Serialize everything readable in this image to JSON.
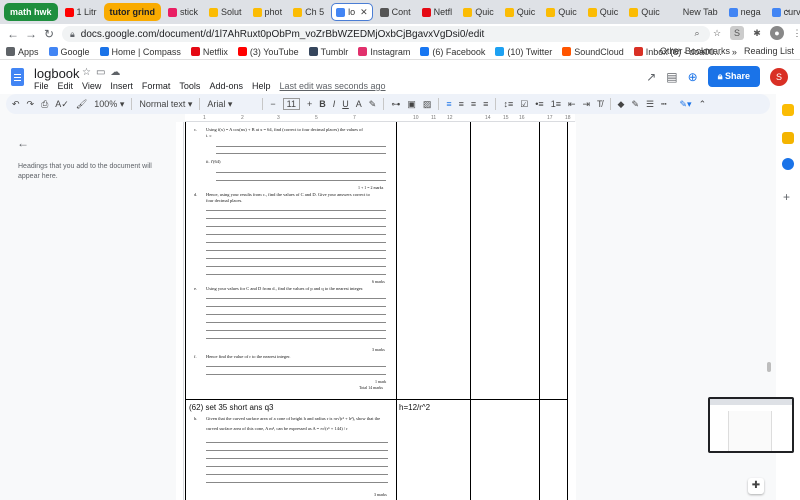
{
  "tabs": [
    {
      "label": "math hwk",
      "group": true,
      "color": "#1e8e3e"
    },
    {
      "label": "1 Litr",
      "color": "#ff0000"
    },
    {
      "label": "tutor grind",
      "group": true,
      "color": "#f9ab00",
      "text_color": "#202124"
    },
    {
      "label": "stick",
      "color": "#e91e63"
    },
    {
      "label": "Solut",
      "color": "#fbbc04"
    },
    {
      "label": "phot",
      "color": "#fbbc04"
    },
    {
      "label": "Ch 5",
      "color": "#fbbc04"
    },
    {
      "label": "lo",
      "active": true,
      "color": "#4285f4"
    },
    {
      "label": "Cont",
      "color": "#555555"
    },
    {
      "label": "Netfl",
      "color": "#e50914"
    },
    {
      "label": "Quic",
      "color": "#fbbc04"
    },
    {
      "label": "Quic",
      "color": "#fbbc04"
    },
    {
      "label": "Quic",
      "color": "#fbbc04"
    },
    {
      "label": "Quic",
      "color": "#fbbc04"
    },
    {
      "label": "Quic",
      "color": "#fbbc04"
    },
    {
      "label": "New Tab",
      "color": "#dee1e6"
    },
    {
      "label": "nega",
      "color": "#4285f4"
    },
    {
      "label": "curv",
      "color": "#4285f4"
    }
  ],
  "address": {
    "url": "docs.google.com/document/d/1l7AhRuxt0pObPm_voZrBbWZEDMjOxbCjBgavxVgDsi0/edit"
  },
  "bookmarks": [
    {
      "label": "Apps",
      "color": "#5f6368"
    },
    {
      "label": "Google",
      "color": "#4285f4"
    },
    {
      "label": "Home | Compass",
      "color": "#1a73e8"
    },
    {
      "label": "Netflix",
      "color": "#e50914"
    },
    {
      "label": "(3) YouTube",
      "color": "#ff0000"
    },
    {
      "label": "Tumblr",
      "color": "#36465d"
    },
    {
      "label": "Instagram",
      "color": "#e1306c"
    },
    {
      "label": "(6) Facebook",
      "color": "#1877f2"
    },
    {
      "label": "(10) Twitter",
      "color": "#1da1f2"
    },
    {
      "label": "SoundCloud",
      "color": "#ff5500"
    },
    {
      "label": "Inbox (8) - doa00...",
      "color": "#d93025"
    }
  ],
  "bookmarks_right": {
    "other": "Other Bookmarks",
    "reading": "Reading List"
  },
  "doc": {
    "title": "logbook",
    "menus": [
      "File",
      "Edit",
      "View",
      "Insert",
      "Format",
      "Tools",
      "Add-ons",
      "Help"
    ],
    "last_edit": "Last edit was seconds ago",
    "share": "Share",
    "avatar": "S"
  },
  "toolbar": {
    "zoom": "100%",
    "style": "Normal text",
    "font": "Arial",
    "size": "11"
  },
  "outline": {
    "hint": "Headings that you add to the document will appear here."
  },
  "page": {
    "c_text": "Using f(x) = A cos(nx) + B at x = 64, find (correct to four decimal places) the values of",
    "c_i": "i.   c",
    "c_ii": "ii.   f'(64)",
    "c_marks": "1 + 1 = 2 marks",
    "d_label": "d.",
    "d_text": "Hence, using your results from c., find the values of C and D. Give your answers correct to",
    "d_text2": "four decimal places.",
    "d_marks": "6 marks",
    "e_label": "e.",
    "e_text": "Using your values for C and D from d., find the values of p and q to the nearest integer.",
    "e_marks": "3 marks",
    "f_label": "f.",
    "f_text": "Hence find the value of r to the nearest integer.",
    "f_marks": "1 mark",
    "total": "Total 14 marks",
    "row62_title": "(62) set 35 short ans q3",
    "row62_answer": "h=12/r^2",
    "b_label": "b.",
    "b_text": "Given that the curved surface area of a cone of height h and radius r is πr√(r² + h²), show that the",
    "b_text2": "curved surface area of this cone, A m², can be expressed as A = π√(r⁶ + 144) / r",
    "b_marks": "3 marks"
  }
}
